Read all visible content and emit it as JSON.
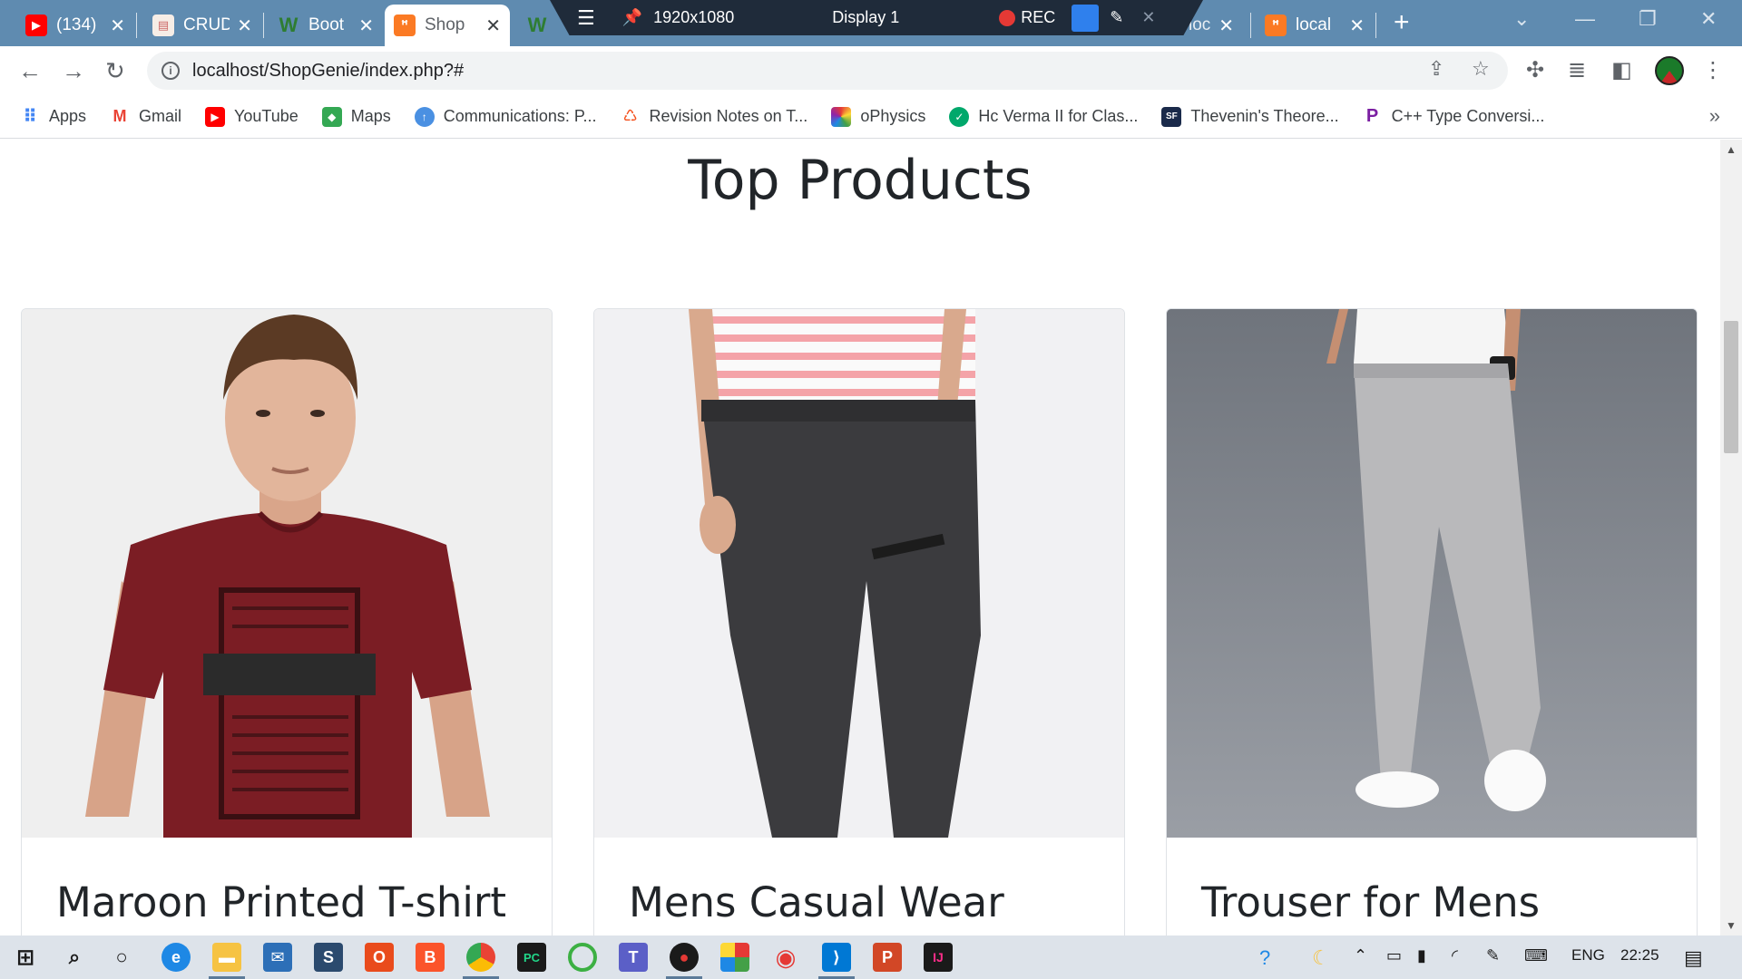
{
  "browser": {
    "tabs": [
      {
        "title": "(134)",
        "favicon": "youtube-icon"
      },
      {
        "title": "CRUD",
        "favicon": "page-icon"
      },
      {
        "title": "Boot",
        "favicon": "w-icon"
      },
      {
        "title": "Shop",
        "favicon": "xampp-icon"
      },
      {
        "title": "W",
        "favicon": "w-icon"
      },
      {
        "title": "local",
        "favicon": "xampp-icon"
      },
      {
        "title": "local",
        "favicon": "xampp-icon"
      }
    ],
    "recorder": {
      "resolution": "1920x1080",
      "display": "Display 1",
      "rec_label": "REC"
    },
    "url": "localhost/ShopGenie/index.php?#",
    "bookmarks": [
      {
        "label": "Apps",
        "icon": "apps-grid-icon",
        "color": "#4285f4"
      },
      {
        "label": "Gmail",
        "icon": "gmail-icon",
        "color": "#ea4335"
      },
      {
        "label": "YouTube",
        "icon": "youtube-icon",
        "color": "#ff0000"
      },
      {
        "label": "Maps",
        "icon": "maps-icon",
        "color": "#34a853"
      },
      {
        "label": "Communications: P...",
        "icon": "upload-icon",
        "color": "#4a90e2"
      },
      {
        "label": "Revision Notes on T...",
        "icon": "notes-icon",
        "color": "#f4511e"
      },
      {
        "label": "oPhysics",
        "icon": "ophysics-icon",
        "color": "#8e24aa"
      },
      {
        "label": "Hc Verma II for Clas...",
        "icon": "globe-icon",
        "color": "#00a86b"
      },
      {
        "label": "Thevenin's Theore...",
        "icon": "sf-icon",
        "color": "#1a2a4a"
      },
      {
        "label": "C++ Type Conversi...",
        "icon": "p-icon",
        "color": "#7b1fa2"
      }
    ]
  },
  "page": {
    "heading": "Top Products",
    "products": [
      {
        "title": "Maroon Printed T-shirt"
      },
      {
        "title": "Mens Casual Wear"
      },
      {
        "title": "Trouser for Mens"
      }
    ]
  },
  "taskbar": {
    "language": "ENG",
    "time": "22:25"
  }
}
